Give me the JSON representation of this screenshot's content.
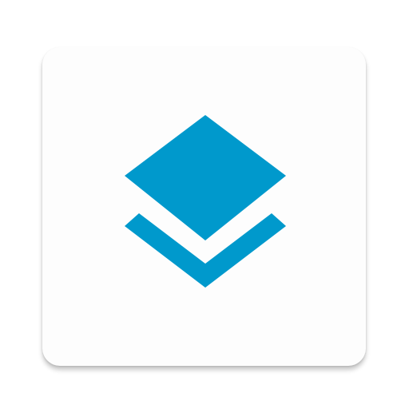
{
  "icon": {
    "name": "layers-icon",
    "color": "#0099cc",
    "tile_color": "#fdfdfd"
  }
}
